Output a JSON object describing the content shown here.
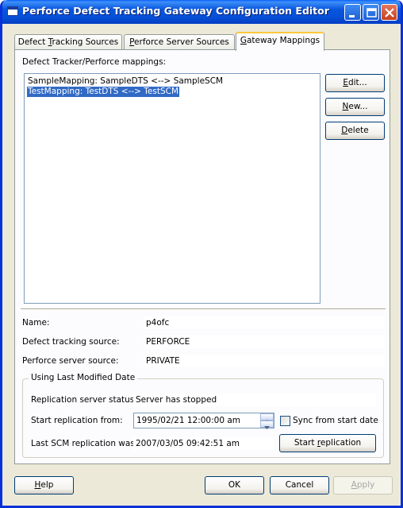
{
  "window": {
    "title": "Perforce Defect Tracking Gateway Configuration Editor",
    "controls": [
      "minimize-icon",
      "maximize-icon",
      "close-icon"
    ]
  },
  "tabs": [
    {
      "label_pre": "Defect ",
      "label_key": "T",
      "label_post": "racking Sources",
      "active": false
    },
    {
      "label_pre": "",
      "label_key": "P",
      "label_post": "erforce Server Sources",
      "active": false
    },
    {
      "label_pre": "",
      "label_key": "G",
      "label_post": "ateway Mappings",
      "active": true
    }
  ],
  "mappings": {
    "heading": "Defect Tracker/Perforce mappings:",
    "items": [
      "SampleMapping: SampleDTS <--> SampleSCM",
      "TestMapping: TestDTS <--> TestSCM"
    ],
    "selected_index": 1,
    "buttons": {
      "edit": {
        "key": "E",
        "rest": "dit..."
      },
      "new": {
        "key": "N",
        "rest": "ew..."
      },
      "delete": {
        "key": "D",
        "rest": "elete"
      }
    }
  },
  "details": {
    "name_label": "Name:",
    "name_value": "p4ofc",
    "dts_label": "Defect tracking source:",
    "dts_value": "PERFORCE",
    "scm_label": "Perforce server source:",
    "scm_value": "PRIVATE"
  },
  "replication": {
    "group_title": "Using Last Modified Date",
    "status_label": "Replication server status:",
    "status_value": "Server has stopped",
    "start_label": "Start replication from:",
    "start_value": "1995/02/21 12:00:00 am",
    "sync_label": "Sync from start date",
    "sync_checked": false,
    "last_label": "Last SCM replication was:",
    "last_value": "2007/03/05 09:42:51 am",
    "start_button": {
      "pre": "Start ",
      "key": "r",
      "rest": "eplication"
    }
  },
  "footer": {
    "help": {
      "key": "H",
      "rest": "elp"
    },
    "ok": "OK",
    "cancel": "Cancel",
    "apply": {
      "key": "A",
      "rest": "pply",
      "enabled": false
    }
  },
  "colors": {
    "title_bar": "#0855dd",
    "selection": "#316ac5",
    "dialog_bg": "#ece9d8"
  }
}
